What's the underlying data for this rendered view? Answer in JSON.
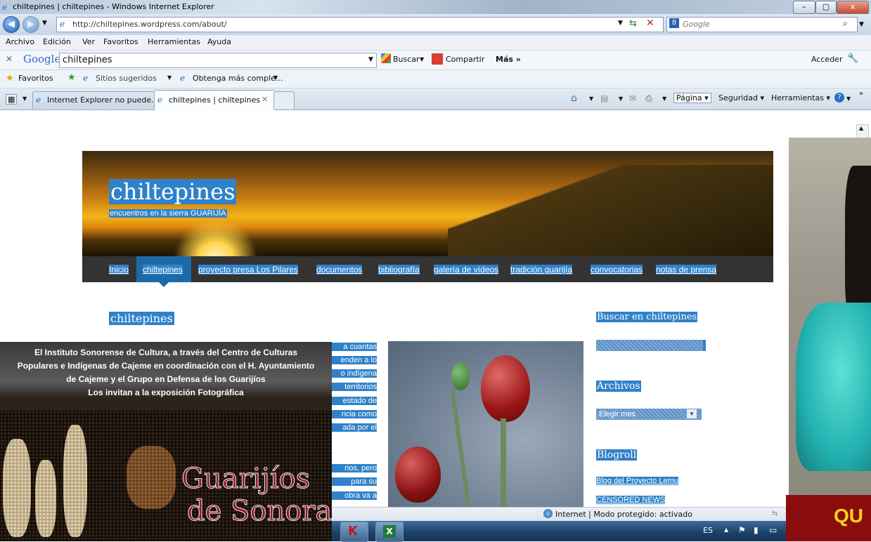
{
  "window": {
    "title": "chiltepines | chiltepines - Windows Internet Explorer",
    "buttons": {
      "minimize": "–",
      "maximize": "▢",
      "close": "x"
    }
  },
  "address": {
    "url": "http://chiltepines.wordpress.com/about/",
    "search_provider": "Google"
  },
  "menu": [
    "Archivo",
    "Edición",
    "Ver",
    "Favoritos",
    "Herramientas",
    "Ayuda"
  ],
  "google_toolbar": {
    "logo": "Google",
    "query": "chiltepines",
    "buscar": "Buscar",
    "compartir": "Compartir",
    "mas": "Más »",
    "acceder": "Acceder"
  },
  "favorites_bar": {
    "favoritos": "Favoritos",
    "sitios": "Sitios sugeridos",
    "obtenga": "Obtenga más comple..."
  },
  "tabs": [
    {
      "label": "Internet Explorer no puede..."
    },
    {
      "label": "chiltepines | chiltepines"
    }
  ],
  "command_bar": {
    "pagina": "Página",
    "seguridad": "Seguridad",
    "herramientas": "Herramientas"
  },
  "blog": {
    "title": "chiltepines",
    "tagline": "encuentros en la sierra GUARIJÍA",
    "nav": [
      "Inicio",
      "chiltepines",
      "proyecto presa Los Pilares",
      "documentos",
      "bibliografía",
      "galería de vídeos",
      "tradición guarijía",
      "convocatorias",
      "notas de prensa"
    ],
    "page_heading": "chiltepines",
    "body_fragments": [
      "a cuantas",
      "enden a lo",
      "o indígena",
      "territorios",
      "estado de",
      "ncia como",
      "ada por el",
      "rios, pero",
      "para su",
      "obra va a"
    ],
    "sidebar": {
      "search_heading": "Buscar en chiltepines",
      "archives_heading": "Archivos",
      "month_select": "Elegir mes",
      "blogroll_heading": "Blogroll",
      "blogroll_links": [
        "Blog del Proyecto Lemu",
        "CENSORED NEWS"
      ]
    }
  },
  "status_bar": {
    "zone": "Internet | Modo protegido: activado"
  },
  "taskbar": {
    "lang": "ES"
  },
  "poster": {
    "text_lines": [
      "El Instituto Sonorense de Cultura, a través del Centro de Culturas",
      "Populares e Indígenas de Cajeme en coordinación con el H. Ayuntamiento",
      "de Cajeme y el Grupo en Defensa de los Guarijíos",
      "Los invitan a la exposición Fotográfica"
    ],
    "title_line1": "Guarijíos",
    "title_line2": "de Sonora"
  },
  "banner": {
    "text": "QU"
  }
}
